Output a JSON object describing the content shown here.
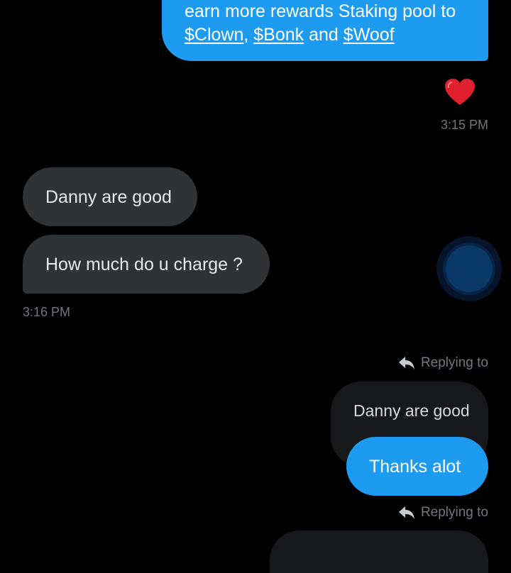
{
  "messages": {
    "top_out": {
      "line1": "earn more rewards Staking pool to",
      "token1": "$Clown",
      "comma": ",",
      "token2": "$Bonk",
      "and": "and",
      "token3": "$Woof"
    },
    "reaction": "❤️",
    "time1": "3:15 PM",
    "in1": "Danny are good",
    "in2": "How much do u charge ?",
    "time2": "3:16 PM",
    "reply1_label": "Replying to",
    "quoted": "Danny are good",
    "out2": "Thanks alot",
    "reply2_label": "Replying to"
  },
  "colors": {
    "outgoing_bubble": "#1d9bf0",
    "incoming_bubble": "#2f3336",
    "quoted_bubble": "#16181c",
    "background": "#000000",
    "muted_text": "#71767b"
  },
  "icons": {
    "reply": "reply-arrow-icon",
    "reaction": "heart-icon",
    "focus": "touch-focus-indicator"
  }
}
